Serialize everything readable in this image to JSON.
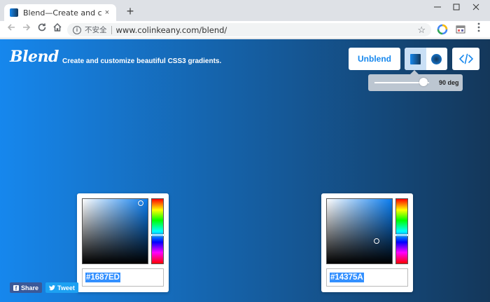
{
  "browser": {
    "tab_title": "Blend—Create and customize ",
    "tab_close": "×",
    "new_tab": "+",
    "security_text": "不安全",
    "url": "www.colinkeany.com/blend/"
  },
  "app": {
    "logo": "Blend",
    "tagline": "Create and customize beautiful CSS3 gradients.",
    "unblend_label": "Unblend",
    "mode_selected": "linear",
    "angle_value": 90,
    "angle_label": "90 deg"
  },
  "colors": {
    "start": "#1687ED",
    "end": "#14375A"
  },
  "pickers": [
    {
      "hex": "#1687ED"
    },
    {
      "hex": "#14375A"
    }
  ],
  "share": {
    "facebook_label": "Share",
    "twitter_label": "Tweet"
  }
}
